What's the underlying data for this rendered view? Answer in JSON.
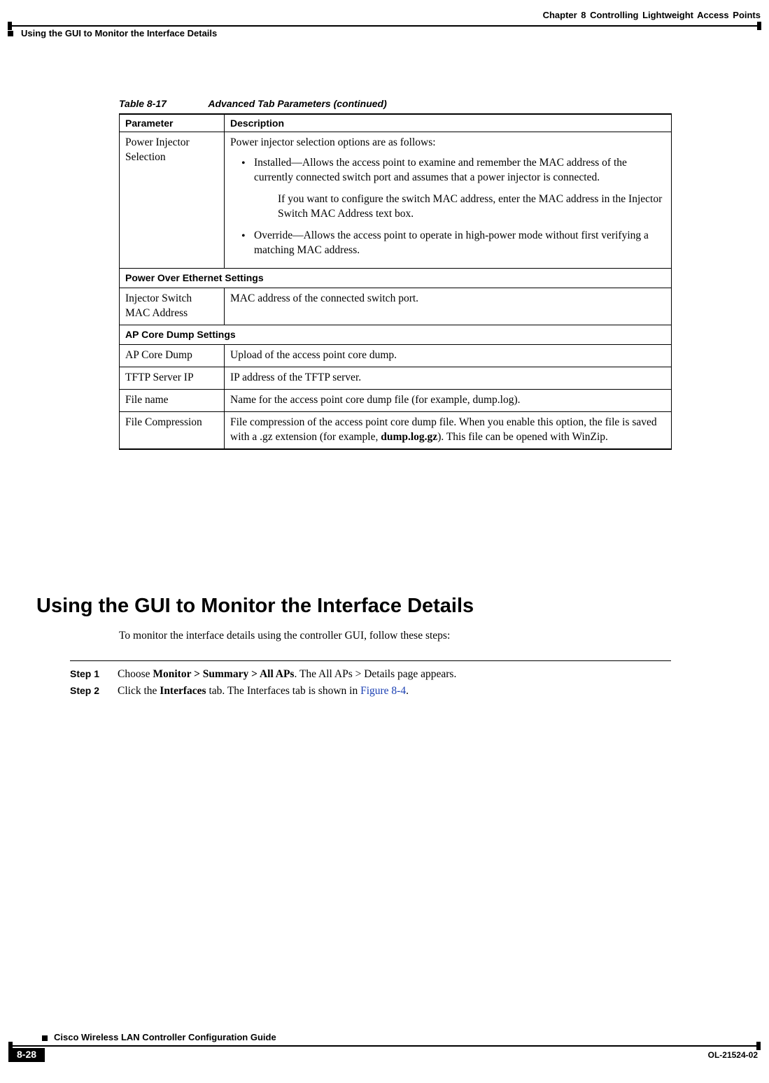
{
  "header": {
    "chapter": "Chapter 8      Controlling Lightweight Access Points",
    "section": "Using the GUI to Monitor the Interface Details"
  },
  "table": {
    "caption_num": "Table 8-17",
    "caption_title": "Advanced Tab Parameters (continued)",
    "col_param": "Parameter",
    "col_desc": "Description",
    "rows": {
      "power_injector": {
        "param": "Power Injector Selection",
        "intro": "Power injector selection options are as follows:",
        "bullet1": "Installed—Allows the access point to examine and remember the MAC address of the currently connected switch port and assumes that a power injector is connected.",
        "bullet1_sub": "If you want to configure the switch MAC address, enter the MAC address in the Injector Switch MAC Address text box.",
        "bullet2": "Override—Allows the access point to operate in high-power mode without first verifying a matching MAC address."
      },
      "section_poe": "Power Over Ethernet Settings",
      "injector_mac": {
        "param": "Injector Switch MAC Address",
        "desc": "MAC address of the connected switch port."
      },
      "section_core": "AP Core Dump Settings",
      "ap_core_dump": {
        "param": "AP Core Dump",
        "desc": "Upload of the access point core dump."
      },
      "tftp": {
        "param": "TFTP Server IP",
        "desc": "IP address of the TFTP server."
      },
      "filename": {
        "param": "File name",
        "desc": "Name for the access point core dump file (for example, dump.log)."
      },
      "file_compression": {
        "param": "File Compression",
        "desc_pre": "File compression of the access point core dump file. When you enable this option, the file is saved with a .gz extension (for example, ",
        "desc_bold": "dump.log.gz",
        "desc_post": "). This file can be opened with WinZip."
      }
    }
  },
  "heading": "Using the GUI to Monitor the Interface Details",
  "intro": "To monitor the interface details using the controller GUI, follow these steps:",
  "steps": {
    "s1": {
      "label": "Step 1",
      "pre": "Choose ",
      "bold": "Monitor > Summary > All APs",
      "post": ". The All APs > Details page appears."
    },
    "s2": {
      "label": "Step 2",
      "pre": "Click the ",
      "bold": "Interfaces",
      "mid": " tab. The Interfaces tab is shown in ",
      "link": "Figure 8-4",
      "post": "."
    }
  },
  "footer": {
    "book": "Cisco Wireless LAN Controller Configuration Guide",
    "page": "8-28",
    "docid": "OL-21524-02"
  }
}
